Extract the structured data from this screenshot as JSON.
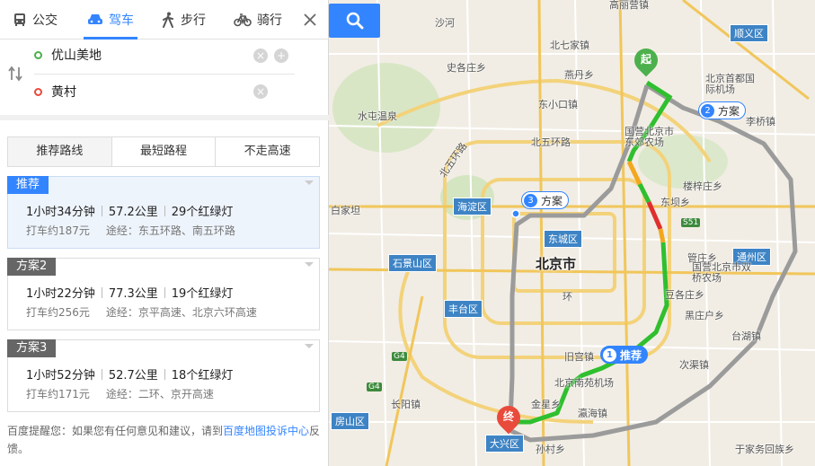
{
  "modes": [
    {
      "label": "公交",
      "icon": "bus-icon"
    },
    {
      "label": "驾车",
      "icon": "car-icon"
    },
    {
      "label": "步行",
      "icon": "walk-icon"
    },
    {
      "label": "骑行",
      "icon": "bike-icon"
    }
  ],
  "active_mode": "驾车",
  "origin": "优山美地",
  "destination": "黄村",
  "preference_tabs": [
    "推荐路线",
    "最短路程",
    "不走高速"
  ],
  "routes": [
    {
      "badge": "推荐",
      "time": "1小时34分钟",
      "distance": "57.2公里",
      "lights": "29个红绿灯",
      "taxi": "打车约187元",
      "via": "途经：东五环路、南五环路"
    },
    {
      "badge": "方案2",
      "time": "1小时22分钟",
      "distance": "77.3公里",
      "lights": "19个红绿灯",
      "taxi": "打车约256元",
      "via": "途经：京平高速、北京六环高速"
    },
    {
      "badge": "方案3",
      "time": "1小时52分钟",
      "distance": "52.7公里",
      "lights": "18个红绿灯",
      "taxi": "打车约171元",
      "via": "途经：二环、京开高速"
    }
  ],
  "tip": {
    "prefix": "百度提醒您：如果您有任何意见和建议，请到",
    "link": "百度地图投诉中心",
    "suffix": "反馈。"
  },
  "map": {
    "city": "北京市",
    "start_label": "起",
    "end_label": "终",
    "route_tags": [
      {
        "num": "1",
        "label": "推荐"
      },
      {
        "num": "2",
        "label": "方案"
      },
      {
        "num": "3",
        "label": "方案"
      }
    ],
    "districts": [
      "顺义区",
      "通州区",
      "海淀区",
      "东城区",
      "石景山区",
      "丰台区",
      "房山区",
      "大兴区"
    ],
    "places": [
      "高丽营镇",
      "沙河",
      "北七家镇",
      "史各庄乡",
      "燕丹乡",
      "北京首都国际机场",
      "东小口镇",
      "水屯温泉",
      "北五环路",
      "北五环路",
      "国营北京市东郊农场",
      "李桥镇",
      "楼梓庄乡",
      "东坝乡",
      "S51",
      "白家坦",
      "旧宫镇",
      "北京南苑机场",
      "金星乡",
      "瀛海镇",
      "长阳镇",
      "管庄乡",
      "国营北京市双桥农场",
      "豆各庄乡",
      "黑庄户乡",
      "台湖镇",
      "次渠镇",
      "于家务回族乡",
      "孙村乡",
      "环",
      "G4",
      "G4"
    ],
    "highways": [
      "G4",
      "G4",
      "S51"
    ],
    "colors": {
      "route_green": "#2fbf2f",
      "route_red": "#e02f2f",
      "route_yellow": "#f2a71d",
      "alt_route": "#9b9b9b",
      "accent": "#3385ff"
    }
  }
}
